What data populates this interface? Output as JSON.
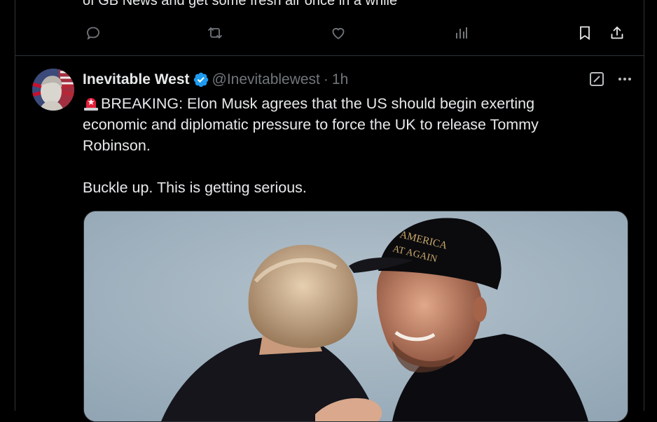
{
  "previous_tweet": {
    "text_fragment": "of GB News and get some fresh air once in a while",
    "actions": {
      "reply_icon": "reply-icon",
      "retweet_icon": "retweet-icon",
      "like_icon": "like-icon",
      "views_icon": "views-icon",
      "bookmark_icon": "bookmark-icon",
      "share_icon": "share-icon"
    }
  },
  "tweet": {
    "display_name": "Inevitable West",
    "handle": "@Inevitablewest",
    "separator": "·",
    "time": "1h",
    "verified_color": "#1d9bf0",
    "body_line1_emoji": "rotating-light-emoji",
    "body_paragraph1": "BREAKING: Elon Musk agrees that the US should begin exerting economic and diplomatic pressure to force the UK to release Tommy Robinson.",
    "body_paragraph2": "Buckle up. This is getting serious.",
    "media_alt": "photo",
    "hat_text_line1": "AMERICA",
    "hat_text_line2": "AT AGAIN"
  },
  "colors": {
    "background": "#000000",
    "text_primary": "#e7e9ea",
    "text_secondary": "#71767b",
    "border": "#2f3336",
    "accent": "#1d9bf0"
  }
}
